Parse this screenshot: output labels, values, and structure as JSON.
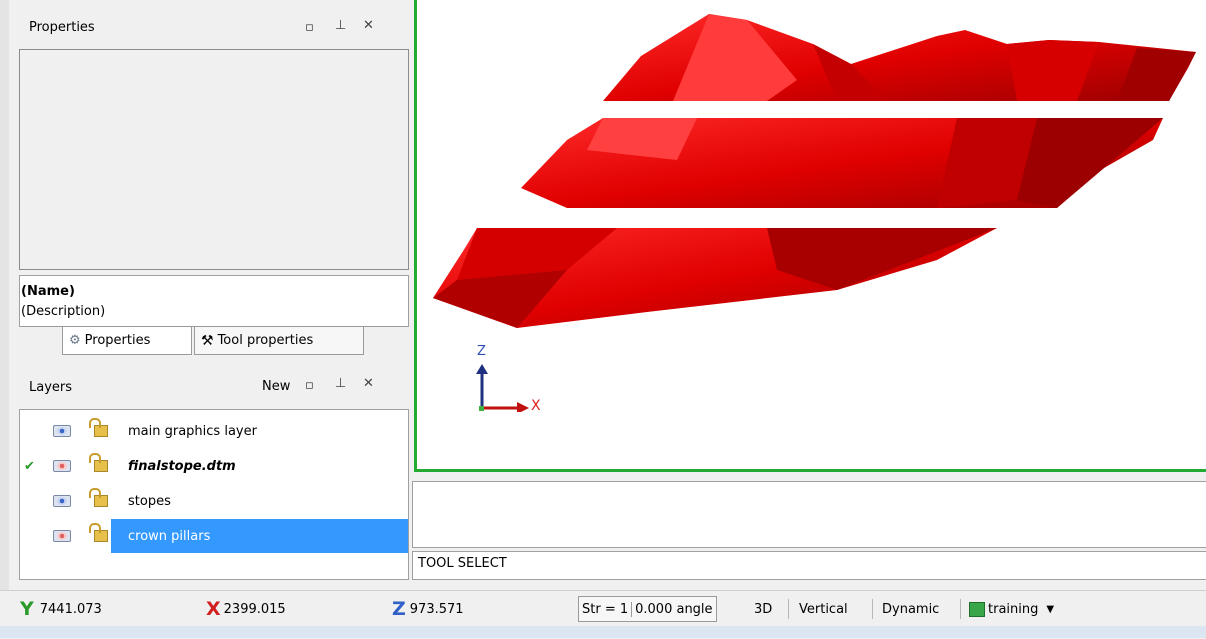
{
  "properties_panel": {
    "title": "Properties",
    "name_label": "(Name)",
    "description_label": "(Description)",
    "tabs": [
      "Properties",
      "Tool properties"
    ]
  },
  "layers_panel": {
    "title": "Layers",
    "new_button": "New",
    "layers": [
      {
        "label": "main graphics layer",
        "visible": true,
        "checked": false,
        "selected": false,
        "bold_italic": false
      },
      {
        "label": "finalstope.dtm",
        "visible": false,
        "checked": true,
        "selected": false,
        "bold_italic": true
      },
      {
        "label": "stopes",
        "visible": true,
        "checked": false,
        "selected": false,
        "bold_italic": false
      },
      {
        "label": "crown pillars",
        "visible": false,
        "checked": false,
        "selected": true,
        "bold_italic": false
      }
    ]
  },
  "viewport": {
    "axis_z": "Z",
    "axis_x": "X"
  },
  "command_area": {
    "tool_status": "TOOL SELECT"
  },
  "status_bar": {
    "y_value": "7441.073",
    "x_value": "2399.015",
    "z_value": "973.571",
    "str_label": "Str = 1",
    "angle_label": "0.000 angle",
    "mode_3d": "3D",
    "vertical": "Vertical",
    "dynamic": "Dynamic",
    "project": "training"
  },
  "colors": {
    "accent_selection": "#3399ff",
    "viewport_border": "#22aa33",
    "solid_red": "#e00000"
  }
}
